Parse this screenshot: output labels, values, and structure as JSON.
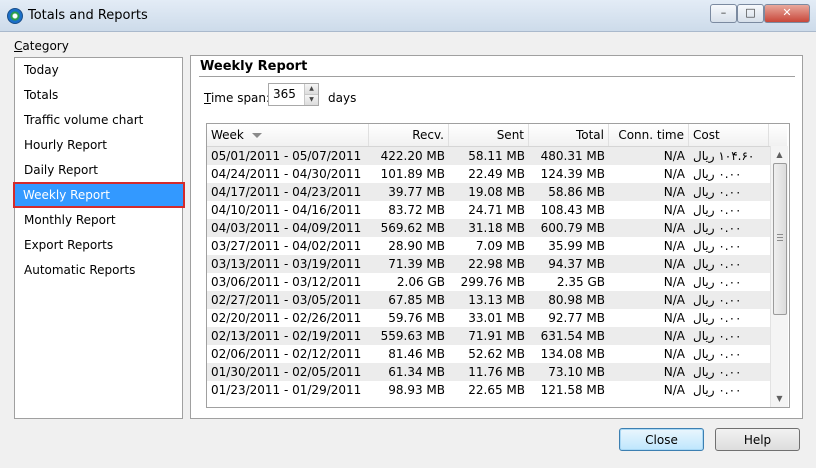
{
  "window": {
    "title": "Totals and Reports",
    "buttons": {
      "minimize": "–",
      "maximize": "□",
      "close": "✕"
    }
  },
  "category": {
    "label_ul": "C",
    "label_rest": "ategory",
    "items": [
      "Today",
      "Totals",
      "Traffic volume chart",
      "Hourly Report",
      "Daily Report",
      "Weekly Report",
      "Monthly Report",
      "Export Reports",
      "Automatic Reports"
    ],
    "selected": "Weekly Report",
    "selected_color": "#3399ff",
    "highlight_color": "#d42b2b"
  },
  "panel": {
    "title": "Weekly Report",
    "timespan_ul": "T",
    "timespan_rest": "ime span:",
    "timespan_value": "365",
    "timespan_unit": "days"
  },
  "table": {
    "columns": [
      "Week",
      "Recv.",
      "Sent",
      "Total",
      "Conn. time",
      "Cost"
    ],
    "rows": [
      [
        "05/01/2011 - 05/07/2011",
        "422.20 MB",
        "58.11 MB",
        "480.31 MB",
        "N/A",
        "١٠۴.۶٠ ريال"
      ],
      [
        "04/24/2011 - 04/30/2011",
        "101.89 MB",
        "22.49 MB",
        "124.39 MB",
        "N/A",
        "٠.٠٠ ريال"
      ],
      [
        "04/17/2011 - 04/23/2011",
        "39.77 MB",
        "19.08 MB",
        "58.86 MB",
        "N/A",
        "٠.٠٠ ريال"
      ],
      [
        "04/10/2011 - 04/16/2011",
        "83.72 MB",
        "24.71 MB",
        "108.43 MB",
        "N/A",
        "٠.٠٠ ريال"
      ],
      [
        "04/03/2011 - 04/09/2011",
        "569.62 MB",
        "31.18 MB",
        "600.79 MB",
        "N/A",
        "٠.٠٠ ريال"
      ],
      [
        "03/27/2011 - 04/02/2011",
        "28.90 MB",
        "7.09 MB",
        "35.99 MB",
        "N/A",
        "٠.٠٠ ريال"
      ],
      [
        "03/13/2011 - 03/19/2011",
        "71.39 MB",
        "22.98 MB",
        "94.37 MB",
        "N/A",
        "٠.٠٠ ريال"
      ],
      [
        "03/06/2011 - 03/12/2011",
        "2.06 GB",
        "299.76 MB",
        "2.35 GB",
        "N/A",
        "٠.٠٠ ريال"
      ],
      [
        "02/27/2011 - 03/05/2011",
        "67.85 MB",
        "13.13 MB",
        "80.98 MB",
        "N/A",
        "٠.٠٠ ريال"
      ],
      [
        "02/20/2011 - 02/26/2011",
        "59.76 MB",
        "33.01 MB",
        "92.77 MB",
        "N/A",
        "٠.٠٠ ريال"
      ],
      [
        "02/13/2011 - 02/19/2011",
        "559.63 MB",
        "71.91 MB",
        "631.54 MB",
        "N/A",
        "٠.٠٠ ريال"
      ],
      [
        "02/06/2011 - 02/12/2011",
        "81.46 MB",
        "52.62 MB",
        "134.08 MB",
        "N/A",
        "٠.٠٠ ريال"
      ],
      [
        "01/30/2011 - 02/05/2011",
        "61.34 MB",
        "11.76 MB",
        "73.10 MB",
        "N/A",
        "٠.٠٠ ريال"
      ],
      [
        "01/23/2011 - 01/29/2011",
        "98.93 MB",
        "22.65 MB",
        "121.58 MB",
        "N/A",
        "٠.٠٠ ريال"
      ]
    ]
  },
  "footer": {
    "close_label": "Close",
    "help_label": "Help"
  }
}
